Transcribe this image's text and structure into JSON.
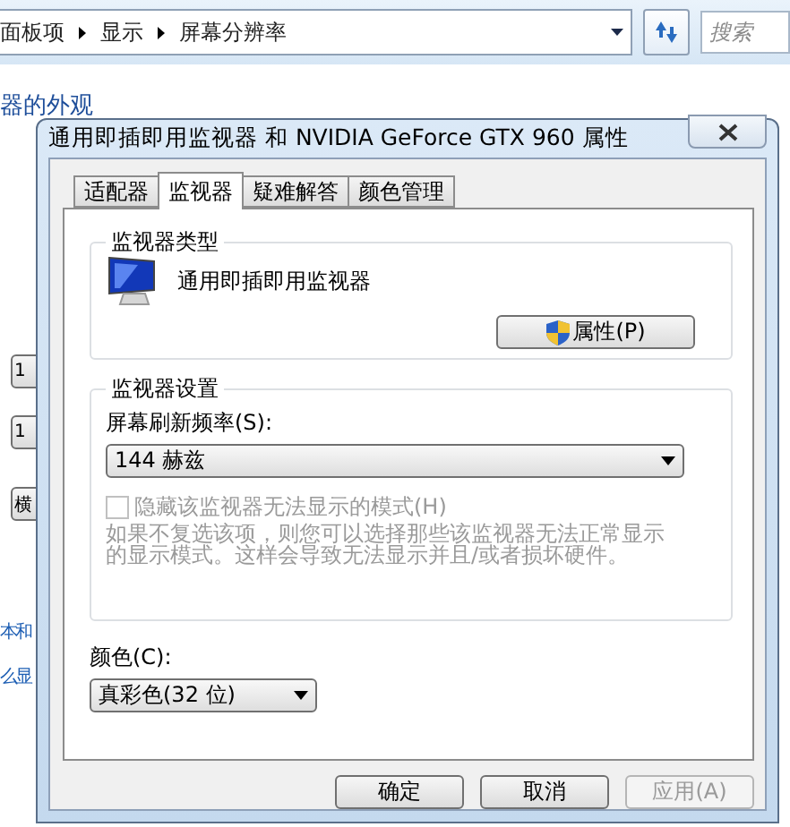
{
  "explorer": {
    "breadcrumb": [
      "面板项",
      "显示",
      "屏幕分辨率"
    ],
    "search": {
      "placeholder": "搜索"
    },
    "heading_link": "器的外观",
    "left_controls": [
      "1",
      "1",
      "横"
    ],
    "links": [
      "本和",
      "么显"
    ]
  },
  "dialog": {
    "title": "通用即插即用监视器 和 NVIDIA GeForce GTX 960 属性",
    "tabs": [
      {
        "label": "适配器",
        "selected": false
      },
      {
        "label": "监视器",
        "selected": true
      },
      {
        "label": "疑难解答",
        "selected": false
      },
      {
        "label": "颜色管理",
        "selected": false
      }
    ],
    "monitor_type": {
      "group_label": "监视器类型",
      "name": "通用即插即用监视器",
      "properties_button": "属性(P)"
    },
    "monitor_settings": {
      "group_label": "监视器设置",
      "refresh_label": "屏幕刷新频率(S):",
      "refresh_value": "144 赫兹",
      "hide_modes": {
        "label": "隐藏该监视器无法显示的模式(H)",
        "checked": false,
        "disabled": true
      },
      "hint": "如果不复选该项，则您可以选择那些该监视器无法正常显示的显示模式。这样会导致无法显示并且/或者损坏硬件。"
    },
    "color": {
      "label": "颜色(C):",
      "value": "真彩色(32 位)"
    },
    "buttons": [
      {
        "label": "确定",
        "disabled": false
      },
      {
        "label": "取消",
        "disabled": false
      },
      {
        "label": "应用(A)",
        "disabled": true
      }
    ]
  }
}
